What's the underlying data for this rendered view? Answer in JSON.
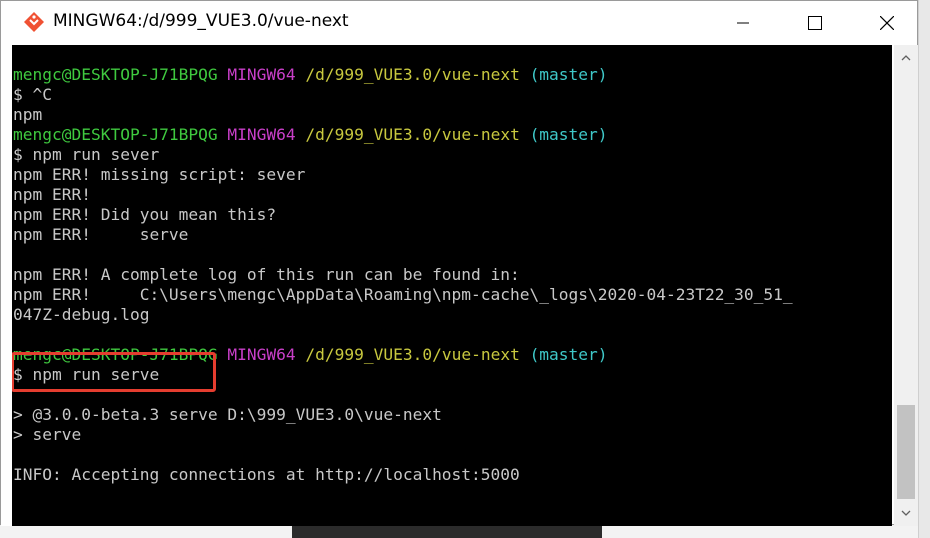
{
  "window": {
    "title": "MINGW64:/d/999_VUE3.0/vue-next",
    "icon": "git-bash-icon",
    "controls": {
      "minimize": "minimize-icon",
      "maximize": "maximize-icon",
      "close": "close-icon"
    }
  },
  "colors": {
    "background": "#000000",
    "text": "#c8c8c8",
    "user": "#3fc93f",
    "system": "#c93fc9",
    "path": "#c8c83f",
    "branch": "#3fc8c8",
    "highlight": "#e53d2f"
  },
  "prompt": {
    "user": "mengc@DESKTOP-J71BPQG",
    "system": "MINGW64",
    "path": "/d/999_VUE3.0/vue-next",
    "branch": "(master)"
  },
  "lines": {
    "l2": "$ ^C",
    "l3": "npm",
    "l5": "$ npm run sever",
    "l6": "npm ERR! missing script: sever",
    "l7": "npm ERR!",
    "l8": "npm ERR! Did you mean this?",
    "l9": "npm ERR!     serve",
    "l11": "npm ERR! A complete log of this run can be found in:",
    "l12": "npm ERR!     C:\\Users\\mengc\\AppData\\Roaming\\npm-cache\\_logs\\2020-04-23T22_30_51_",
    "l13": "047Z-debug.log",
    "l15": "$ npm run serve",
    "l17": "> @3.0.0-beta.3 serve D:\\999_VUE3.0\\vue-next",
    "l18": "> serve",
    "l20": "INFO: Accepting connections at http://localhost:5000"
  }
}
